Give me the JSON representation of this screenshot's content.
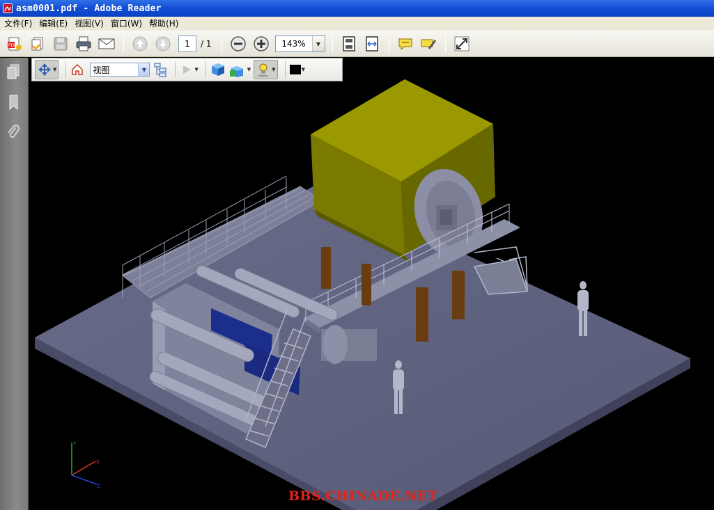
{
  "window": {
    "title": "asm0001.pdf - Adobe Reader"
  },
  "menu": {
    "items": [
      "文件(F)",
      "编辑(E)",
      "视图(V)",
      "窗口(W)",
      "帮助(H)"
    ]
  },
  "toolbar": {
    "page_current": "1",
    "page_total": "/ 1",
    "zoom": "143%",
    "icons": [
      "create-pdf-icon",
      "organize-icon",
      "save-icon",
      "print-icon",
      "email-icon",
      "previous-page-icon",
      "next-page-icon",
      "zoom-out-icon",
      "zoom-in-icon",
      "fit-page-icon",
      "fit-width-icon",
      "comment-icon",
      "highlight-icon",
      "fullscreen-icon"
    ]
  },
  "navpane": {
    "icons": [
      "pages-icon",
      "bookmarks-icon",
      "attachments-icon"
    ]
  },
  "toolbar3d": {
    "view_select": "视图",
    "icons": [
      "rotate-icon",
      "home-view-icon",
      "model-tree-icon",
      "play-icon",
      "render-mode-icon",
      "lighting-icon",
      "background-color-icon"
    ],
    "background_color": "#000000"
  },
  "scene": {
    "housing_color": "#8a8a00",
    "floor_color": "#5c5f7a",
    "roll_color": "#1c2e8c",
    "axis_labels": {
      "x": "X",
      "y": "Y",
      "z": "Z"
    }
  },
  "watermark": "BBS.CHINADE.NET"
}
